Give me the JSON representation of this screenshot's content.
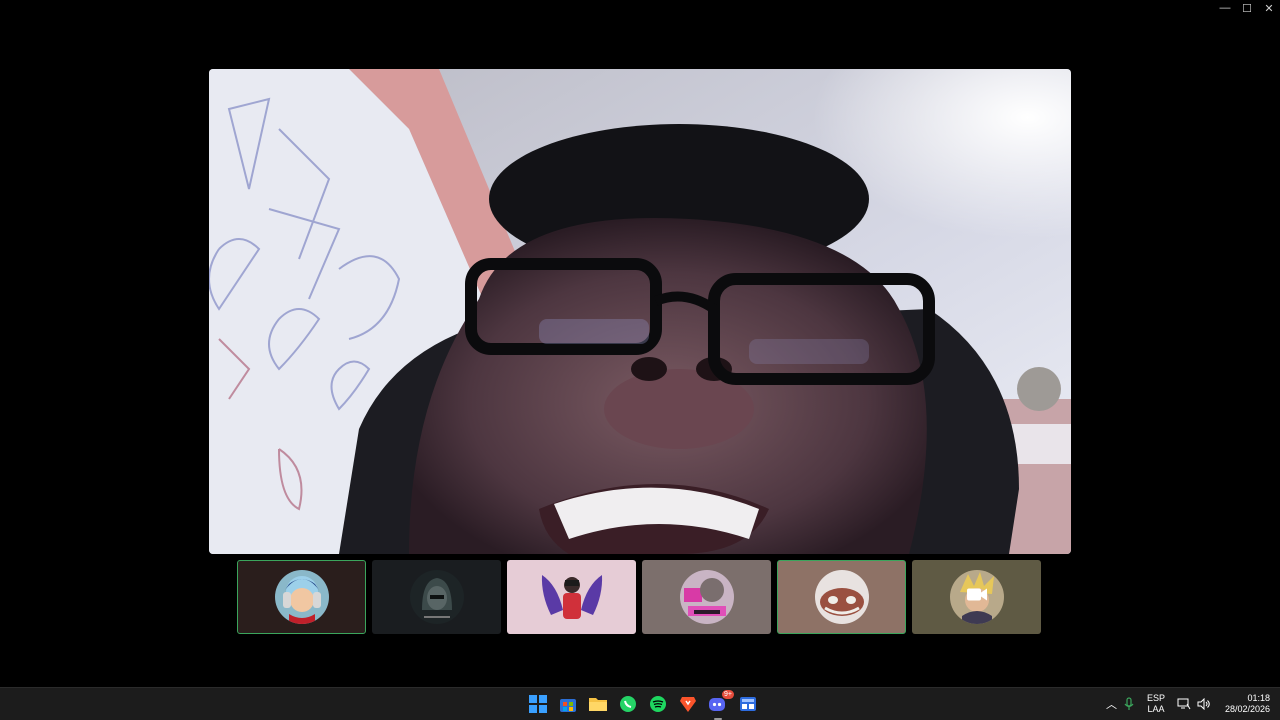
{
  "window": {
    "controls": [
      {
        "name": "minimize-icon",
        "glyph": "—"
      },
      {
        "name": "maximize-icon",
        "glyph": "☐"
      },
      {
        "name": "close-icon",
        "glyph": "✕"
      }
    ]
  },
  "participants": [
    {
      "name": "participant-tile-1",
      "active": true,
      "background": "#2a1e1c",
      "avatar_icon": "anime-boy-avatar-icon"
    },
    {
      "name": "participant-tile-2",
      "active": false,
      "background": "#1a1d20",
      "avatar_icon": "hooded-figure-avatar-icon"
    },
    {
      "name": "participant-tile-3",
      "active": false,
      "background": "#e6ccd6",
      "avatar_icon": "winged-figure-avatar-icon"
    },
    {
      "name": "participant-tile-4",
      "active": false,
      "background": "#7c6f6c",
      "avatar_icon": "neon-collage-avatar-icon"
    },
    {
      "name": "participant-tile-5",
      "active": true,
      "background": "#8e7266",
      "avatar_icon": "creature-avatar-icon"
    },
    {
      "name": "participant-tile-6",
      "active": false,
      "background": "#5f5a44",
      "avatar_icon": "camera-icon"
    }
  ],
  "taskbar": {
    "apps": [
      {
        "name": "windows-start-icon",
        "color": "#3aa0ff"
      },
      {
        "name": "store-icon",
        "color": "#f2c94c"
      },
      {
        "name": "file-explorer-icon",
        "color": "#f6c244"
      },
      {
        "name": "whatsapp-icon",
        "color": "#25d366"
      },
      {
        "name": "spotify-icon",
        "color": "#1ed760"
      },
      {
        "name": "brave-icon",
        "color": "#fb542b"
      },
      {
        "name": "discord-icon",
        "color": "#5865f2",
        "badge": "9+"
      },
      {
        "name": "dashboard-app-icon",
        "color": "#2d6cdf"
      }
    ],
    "tray": {
      "lang_top": "ESP",
      "lang_bottom": "LAA",
      "time": "01:18",
      "date": "28/02/2026"
    }
  }
}
